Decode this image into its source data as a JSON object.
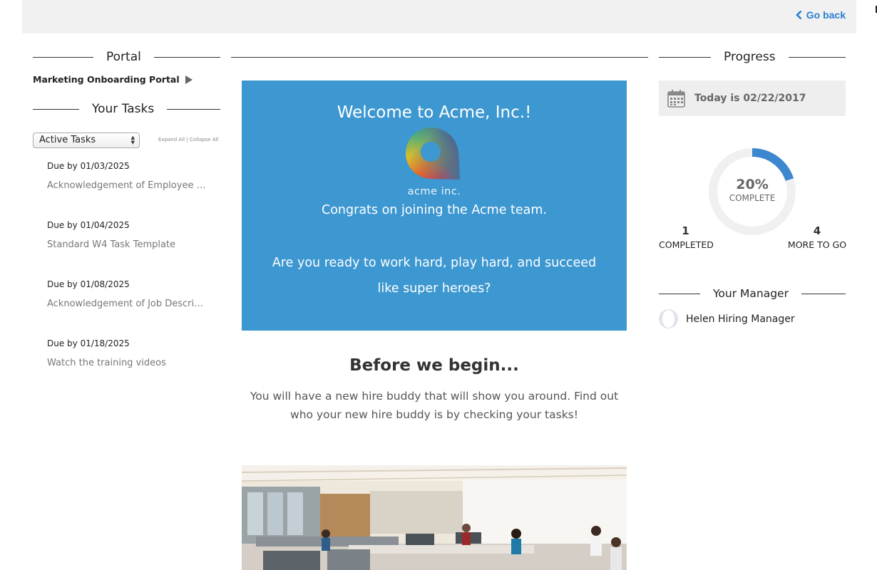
{
  "header": {
    "go_back_label": "Go back"
  },
  "left": {
    "portal_heading": "Portal",
    "portal_name": "Marketing Onboarding Portal",
    "tasks_heading": "Your Tasks",
    "filter_value": "Active Tasks",
    "expand_all": "Expand All",
    "separator": "|",
    "collapse_all": "Collapse All",
    "tasks": [
      {
        "due": "Due by 01/03/2025",
        "title": "Acknowledgement of Employee Handbook"
      },
      {
        "due": "Due by 01/04/2025",
        "title": "Standard W4 Task Template"
      },
      {
        "due": "Due by 01/08/2025",
        "title": "Acknowledgement of Job Description"
      },
      {
        "due": "Due by 01/18/2025",
        "title": "Watch the training videos"
      }
    ]
  },
  "main": {
    "welcome": "Welcome to Acme, Inc.!",
    "logo_text": "acme inc.",
    "congrats": "Congrats on joining the Acme team.",
    "ready": "Are you ready to work hard, play hard, and succeed like super heroes?",
    "before_title": "Before we begin...",
    "buddy_text": "You will have a new hire buddy that will show you around. Find out who your new hire buddy is by checking your tasks!"
  },
  "right": {
    "progress_heading": "Progress",
    "today": "Today is 02/22/2017",
    "percent_label": "20%",
    "percent_value": 0.2,
    "complete_label": "COMPLETE",
    "completed_count": "1",
    "completed_label": "COMPLETED",
    "remaining_count": "4",
    "remaining_label": "MORE TO GO",
    "manager_heading": "Your Manager",
    "manager_name": "Helen Hiring Manager"
  },
  "colors": {
    "accent": "#2a7fd0",
    "banner": "#3d97d0",
    "progress": "#3d86d0",
    "track": "#f0f0f0"
  }
}
